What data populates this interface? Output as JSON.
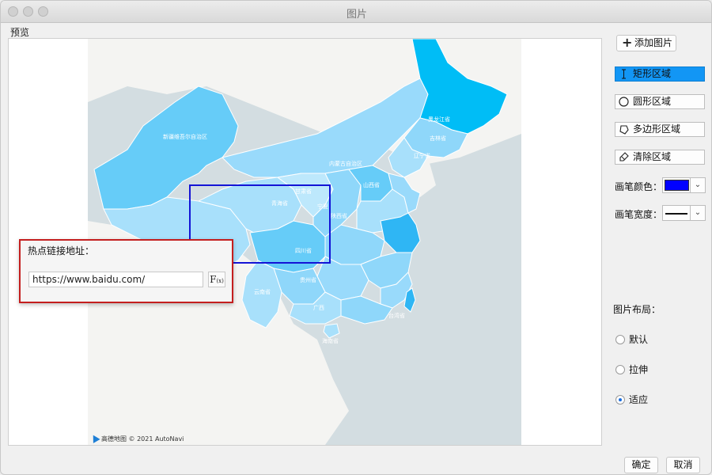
{
  "window": {
    "title": "图片"
  },
  "preview": {
    "label": "预览",
    "map_credit": "高德地图 © 2021 AutoNavi",
    "regions": [
      "新疆维吾尔自治区",
      "黑龙江省",
      "吉林省",
      "辽宁省",
      "内蒙古自治区",
      "青海省",
      "四川省",
      "贵州省",
      "云南省",
      "广西",
      "海南省",
      "台湾省",
      "山西省",
      "甘肃省",
      "宁夏",
      "陕西省"
    ]
  },
  "hotspot_panel": {
    "label": "热点链接地址：",
    "url": "https://www.baidu.com/",
    "fx_label": "F",
    "fx_sub": "(x)"
  },
  "toolbar": {
    "add_image": "添加图片",
    "rect_region": "矩形区域",
    "circle_region": "圆形区域",
    "polygon_region": "多边形区域",
    "clear_region": "清除区域",
    "brush_color_label": "画笔颜色：",
    "brush_color": "#0000ff",
    "brush_width_label": "画笔宽度："
  },
  "layout": {
    "label": "图片布局：",
    "options": [
      "默认",
      "拉伸",
      "适应"
    ],
    "selected": "适应"
  },
  "footer": {
    "ok": "确定",
    "cancel": "取消"
  },
  "colors": {
    "accent": "#1296f5",
    "hotspot_border": "#c41f1f",
    "selection_border": "#1414d6"
  }
}
